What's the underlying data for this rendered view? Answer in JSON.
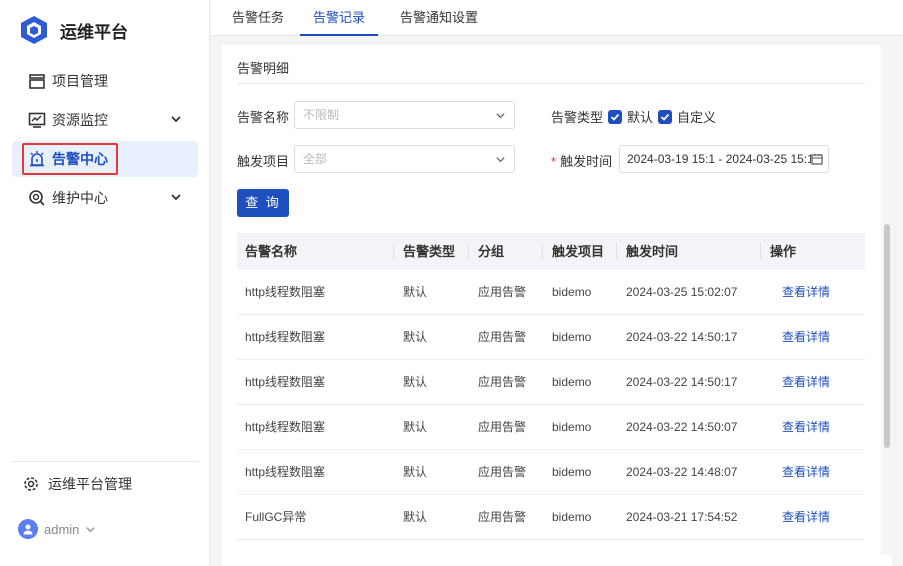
{
  "app": {
    "title": "运维平台"
  },
  "sidebar": {
    "items": [
      {
        "label": "项目管理",
        "icon": "folder-icon",
        "expandable": false
      },
      {
        "label": "资源监控",
        "icon": "monitor-chart-icon",
        "expandable": true
      },
      {
        "label": "告警中心",
        "icon": "alarm-icon",
        "expandable": false,
        "active": true
      },
      {
        "label": "维护中心",
        "icon": "search-shield-icon",
        "expandable": true
      }
    ],
    "bottom": {
      "label": "运维平台管理",
      "icon": "gear-icon"
    },
    "user": {
      "name": "admin"
    }
  },
  "tabs": [
    {
      "label": "告警任务"
    },
    {
      "label": "告警记录",
      "active": true
    },
    {
      "label": "告警通知设置"
    }
  ],
  "section": {
    "title": "告警明细"
  },
  "filters": {
    "alarm_name": {
      "label": "告警名称",
      "placeholder": "不限制"
    },
    "alarm_type": {
      "label": "告警类型",
      "options": [
        {
          "label": "默认",
          "checked": true
        },
        {
          "label": "自定义",
          "checked": true
        }
      ]
    },
    "trigger_project": {
      "label": "触发项目",
      "placeholder": "全部"
    },
    "trigger_time": {
      "label": "触发时间",
      "required": true,
      "value": "2024-03-19 15:1 - 2024-03-25 15:1"
    },
    "query_button": "查 询"
  },
  "table": {
    "headers": [
      "告警名称",
      "告警类型",
      "分组",
      "触发项目",
      "触发时间",
      "操作"
    ],
    "rows": [
      {
        "name": "http线程数阻塞",
        "type": "默认",
        "group": "应用告警",
        "project": "bidemo",
        "time": "2024-03-25 15:02:07",
        "action": "查看详情"
      },
      {
        "name": "http线程数阻塞",
        "type": "默认",
        "group": "应用告警",
        "project": "bidemo",
        "time": "2024-03-22 14:50:17",
        "action": "查看详情"
      },
      {
        "name": "http线程数阻塞",
        "type": "默认",
        "group": "应用告警",
        "project": "bidemo",
        "time": "2024-03-22 14:50:17",
        "action": "查看详情"
      },
      {
        "name": "http线程数阻塞",
        "type": "默认",
        "group": "应用告警",
        "project": "bidemo",
        "time": "2024-03-22 14:50:07",
        "action": "查看详情"
      },
      {
        "name": "http线程数阻塞",
        "type": "默认",
        "group": "应用告警",
        "project": "bidemo",
        "time": "2024-03-22 14:48:07",
        "action": "查看详情"
      },
      {
        "name": "FullGC异常",
        "type": "默认",
        "group": "应用告警",
        "project": "bidemo",
        "time": "2024-03-21 17:54:52",
        "action": "查看详情"
      }
    ]
  },
  "colors": {
    "accent": "#1f4fbf",
    "active_bg": "#e8f0fd",
    "highlight_border": "#e5383b",
    "required": "#e5383b"
  }
}
